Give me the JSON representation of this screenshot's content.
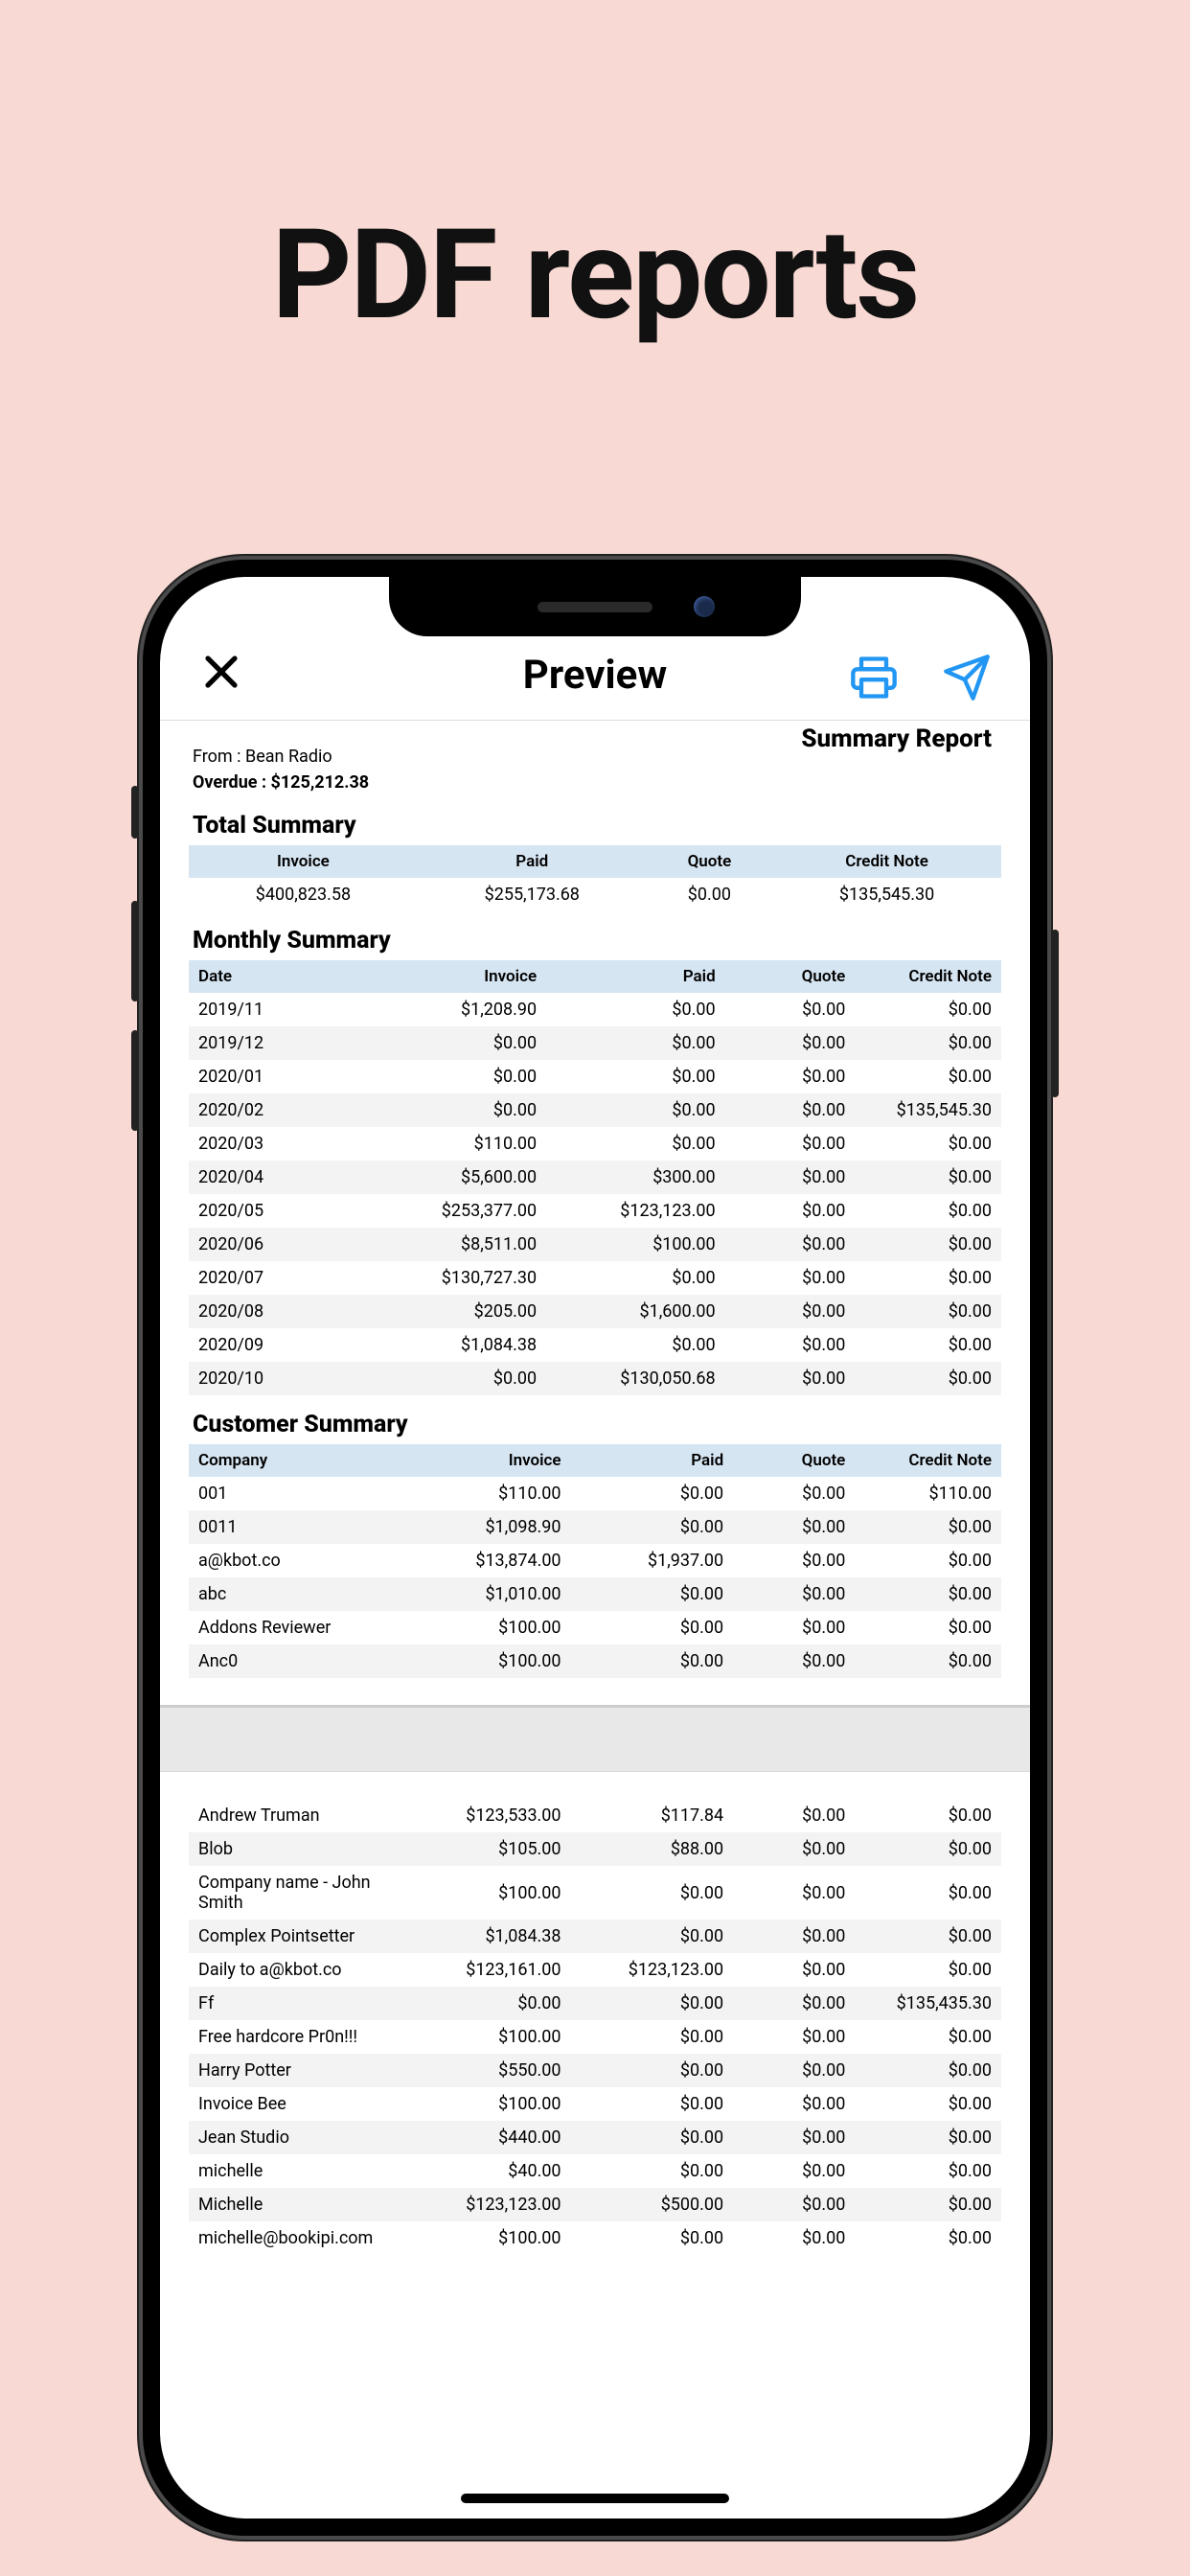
{
  "promo_title": "PDF reports",
  "nav": {
    "title": "Preview"
  },
  "report": {
    "heading": "Summary Report",
    "from_line": "From : Bean Radio",
    "overdue_line": "Overdue : $125,212.38",
    "total_summary": {
      "title": "Total Summary",
      "columns": [
        "Invoice",
        "Paid",
        "Quote",
        "Credit Note"
      ],
      "row": [
        "$400,823.58",
        "$255,173.68",
        "$0.00",
        "$135,545.30"
      ]
    },
    "monthly_summary": {
      "title": "Monthly Summary",
      "columns": [
        "Date",
        "Invoice",
        "Paid",
        "Quote",
        "Credit Note"
      ],
      "rows": [
        [
          "2019/11",
          "$1,208.90",
          "$0.00",
          "$0.00",
          "$0.00"
        ],
        [
          "2019/12",
          "$0.00",
          "$0.00",
          "$0.00",
          "$0.00"
        ],
        [
          "2020/01",
          "$0.00",
          "$0.00",
          "$0.00",
          "$0.00"
        ],
        [
          "2020/02",
          "$0.00",
          "$0.00",
          "$0.00",
          "$135,545.30"
        ],
        [
          "2020/03",
          "$110.00",
          "$0.00",
          "$0.00",
          "$0.00"
        ],
        [
          "2020/04",
          "$5,600.00",
          "$300.00",
          "$0.00",
          "$0.00"
        ],
        [
          "2020/05",
          "$253,377.00",
          "$123,123.00",
          "$0.00",
          "$0.00"
        ],
        [
          "2020/06",
          "$8,511.00",
          "$100.00",
          "$0.00",
          "$0.00"
        ],
        [
          "2020/07",
          "$130,727.30",
          "$0.00",
          "$0.00",
          "$0.00"
        ],
        [
          "2020/08",
          "$205.00",
          "$1,600.00",
          "$0.00",
          "$0.00"
        ],
        [
          "2020/09",
          "$1,084.38",
          "$0.00",
          "$0.00",
          "$0.00"
        ],
        [
          "2020/10",
          "$0.00",
          "$130,050.68",
          "$0.00",
          "$0.00"
        ]
      ]
    },
    "customer_summary": {
      "title": "Customer Summary",
      "columns": [
        "Company",
        "Invoice",
        "Paid",
        "Quote",
        "Credit Note"
      ],
      "page1": [
        [
          "001",
          "$110.00",
          "$0.00",
          "$0.00",
          "$110.00"
        ],
        [
          "0011",
          "$1,098.90",
          "$0.00",
          "$0.00",
          "$0.00"
        ],
        [
          "a@kbot.co",
          "$13,874.00",
          "$1,937.00",
          "$0.00",
          "$0.00"
        ],
        [
          "abc",
          "$1,010.00",
          "$0.00",
          "$0.00",
          "$0.00"
        ],
        [
          "Addons Reviewer",
          "$100.00",
          "$0.00",
          "$0.00",
          "$0.00"
        ],
        [
          "Anc0",
          "$100.00",
          "$0.00",
          "$0.00",
          "$0.00"
        ]
      ],
      "page2": [
        [
          "Andrew Truman",
          "$123,533.00",
          "$117.84",
          "$0.00",
          "$0.00"
        ],
        [
          "Blob",
          "$105.00",
          "$88.00",
          "$0.00",
          "$0.00"
        ],
        [
          "Company name - John Smith",
          "$100.00",
          "$0.00",
          "$0.00",
          "$0.00"
        ],
        [
          "Complex Pointsetter",
          "$1,084.38",
          "$0.00",
          "$0.00",
          "$0.00"
        ],
        [
          "Daily to a@kbot.co",
          "$123,161.00",
          "$123,123.00",
          "$0.00",
          "$0.00"
        ],
        [
          "Ff",
          "$0.00",
          "$0.00",
          "$0.00",
          "$135,435.30"
        ],
        [
          "Free hardcore Pr0n!!!",
          "$100.00",
          "$0.00",
          "$0.00",
          "$0.00"
        ],
        [
          "Harry Potter",
          "$550.00",
          "$0.00",
          "$0.00",
          "$0.00"
        ],
        [
          "Invoice Bee",
          "$100.00",
          "$0.00",
          "$0.00",
          "$0.00"
        ],
        [
          "Jean Studio",
          "$440.00",
          "$0.00",
          "$0.00",
          "$0.00"
        ],
        [
          "michelle",
          "$40.00",
          "$0.00",
          "$0.00",
          "$0.00"
        ],
        [
          "Michelle",
          "$123,123.00",
          "$500.00",
          "$0.00",
          "$0.00"
        ],
        [
          "michelle@bookipi.com",
          "$100.00",
          "$0.00",
          "$0.00",
          "$0.00"
        ]
      ]
    }
  }
}
